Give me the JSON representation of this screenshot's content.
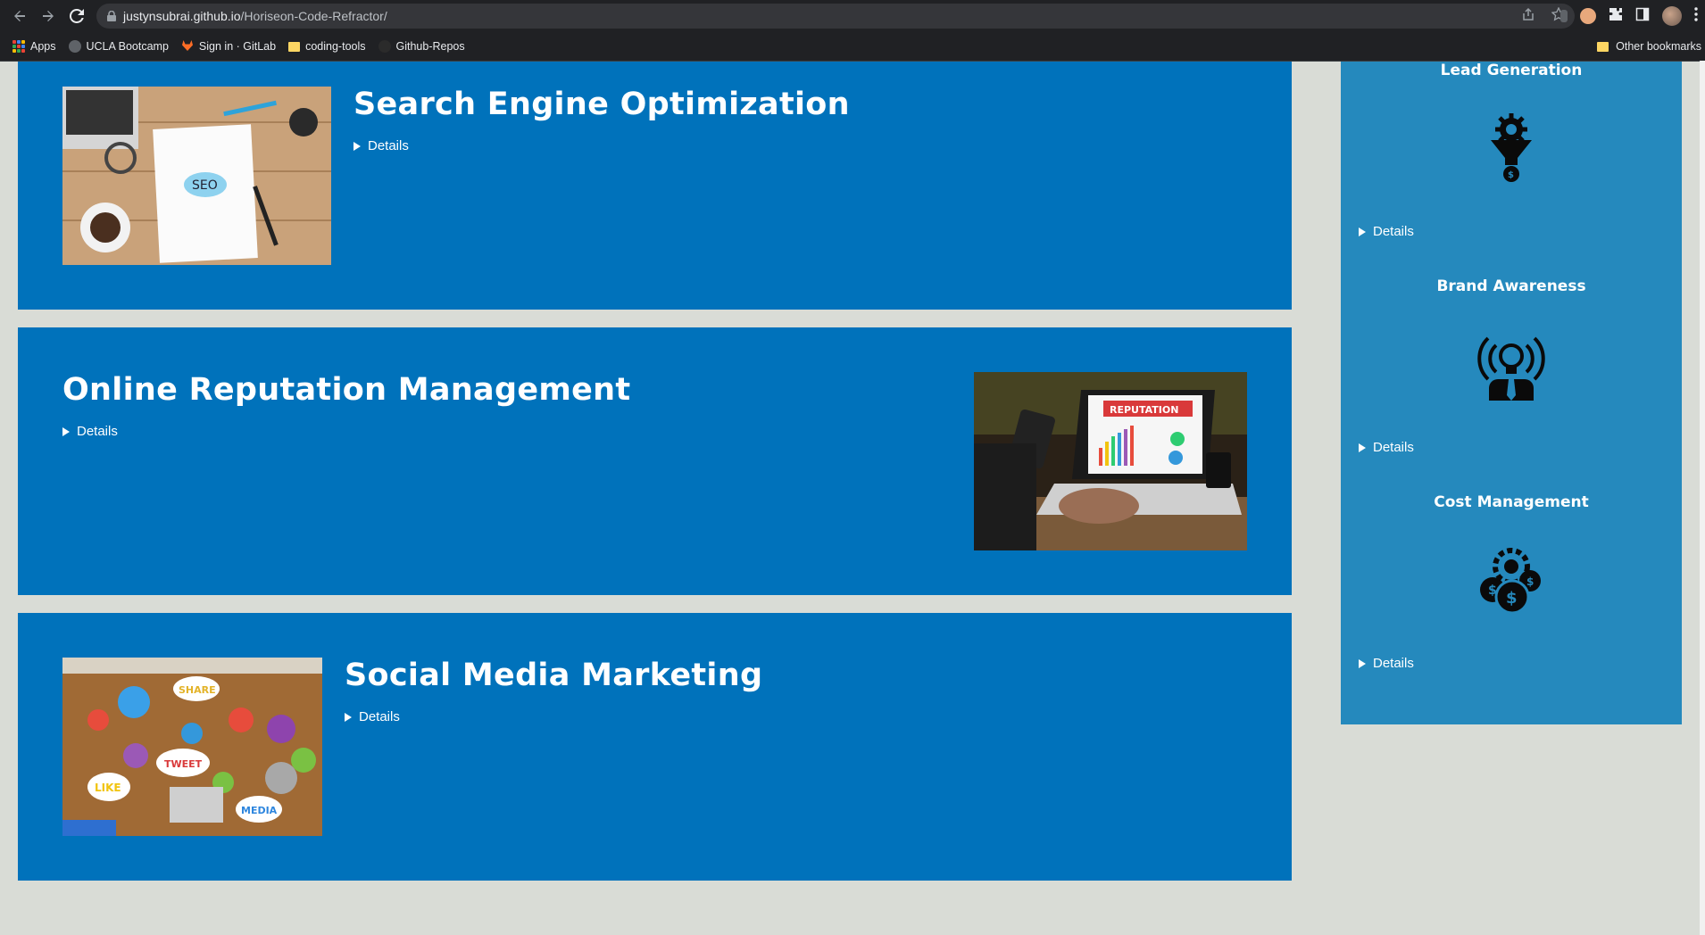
{
  "browser": {
    "url_host": "justynsubrai.github.io",
    "url_path": "/Horiseon-Code-Refractor/",
    "bookmarks": [
      {
        "label": "Apps",
        "icon": "apps-grid-icon"
      },
      {
        "label": "UCLA Bootcamp",
        "icon": "globe-icon"
      },
      {
        "label": "Sign in · GitLab",
        "icon": "gitlab-icon"
      },
      {
        "label": "coding-tools",
        "icon": "folder-icon"
      },
      {
        "label": "Github-Repos",
        "icon": "github-icon"
      }
    ],
    "other_bookmarks": "Other bookmarks"
  },
  "services": [
    {
      "title": "Search Engine Optimization",
      "details": "Details",
      "image": "seo-notebook-desk-photo"
    },
    {
      "title": "Online Reputation Management",
      "details": "Details",
      "image": "reputation-laptop-photo"
    },
    {
      "title": "Social Media Marketing",
      "details": "Details",
      "image": "social-media-table-photo"
    }
  ],
  "benefits": [
    {
      "title": "Lead Generation",
      "details": "Details",
      "icon": "lead-generation-funnel-icon"
    },
    {
      "title": "Brand Awareness",
      "details": "Details",
      "icon": "brand-awareness-lightbulb-icon"
    },
    {
      "title": "Cost Management",
      "details": "Details",
      "icon": "cost-management-coins-icon"
    }
  ],
  "colors": {
    "page_bg": "#d9dcd6",
    "card_bg": "#0072bb",
    "sidebar_bg": "#2589bd",
    "chrome_bg": "#202124"
  }
}
